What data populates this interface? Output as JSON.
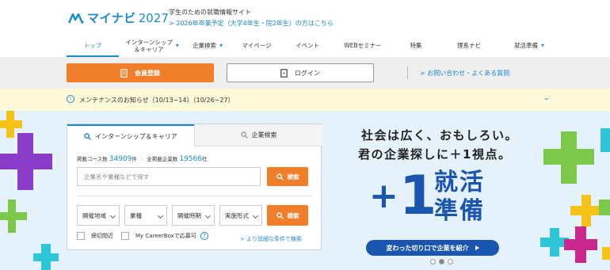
{
  "brand": {
    "logo_text": "マイナビ",
    "logo_year": "2027",
    "tagline": "学生のための就職情報サイト",
    "sublink": "> 2026年卒業予定（大学4年生・院2年生）の方はこちら"
  },
  "nav": {
    "items": [
      {
        "label": "トップ"
      },
      {
        "label": "インターンシップ\n＆キャリア"
      },
      {
        "label": "企業検索"
      },
      {
        "label": "マイページ"
      },
      {
        "label": "イベント"
      },
      {
        "label": "WEBセミナー"
      },
      {
        "label": "特集"
      },
      {
        "label": "理系ナビ"
      },
      {
        "label": "就活準備"
      }
    ]
  },
  "actions": {
    "register_label": "会員登録",
    "login_label": "ログイン",
    "contact_label": "> お問い合わせ・よくある質問"
  },
  "notice": {
    "text": "メンテナンスのお知らせ（10/13−14）（10/26−27）"
  },
  "search": {
    "tab_internship": "インターンシップ＆キャリア",
    "tab_company": "企業検索",
    "count_course_label": "掲載コース数",
    "count_course_value": "34909",
    "count_course_unit": "件",
    "count_company_label": "全掲載企業数",
    "count_company_value": "19566",
    "count_company_unit": "社",
    "keyword_placeholder": "企業名や業種などで探す",
    "search_label": "検索",
    "filters": {
      "region": "開催地域",
      "industry": "業種",
      "period": "開催時期",
      "format": "実施形式"
    },
    "closing_soon": "締切間近",
    "careerbox": "My CareerBoxで応募可",
    "detail_link": "> より詳細な条件で検索"
  },
  "hero": {
    "slogan_line1": "社会は広く、おもしろい。",
    "slogan_line2": "君の企業探しに＋1視点。",
    "big_plus": "+",
    "big_one": "1",
    "kanji_top": "就活",
    "kanji_bottom": "準備",
    "button_label": "変わった切り口で企業を紹介"
  },
  "colors": {
    "brand_blue": "#1a8ad0",
    "hero_blue": "#1a56b0",
    "orange": "#f07e2a",
    "green": "#7cc84a",
    "purple": "#8a3bc8",
    "yellow": "#f5c21a",
    "teal": "#2fc7d8",
    "magenta": "#c8288e"
  },
  "icons": [
    "search-icon",
    "login-door-icon",
    "register-doc-icon",
    "info-icon",
    "help-icon"
  ]
}
